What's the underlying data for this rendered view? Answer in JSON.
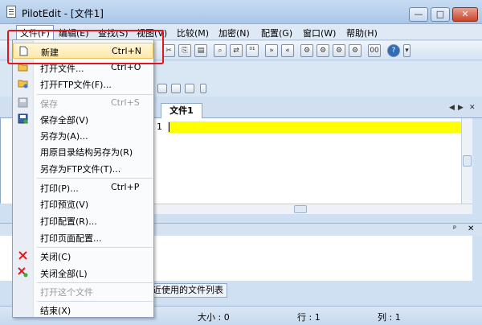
{
  "window": {
    "title": "PilotEdit - [文件1]",
    "min_label": "—",
    "max_label": "□",
    "close_label": "✕"
  },
  "menubar": {
    "items": [
      "文件(F)",
      "编辑(E)",
      "查找(S)",
      "视图(V)",
      "比较(M)",
      "加密(N)",
      "配置(G)",
      "窗口(W)",
      "帮助(H)"
    ]
  },
  "file_menu": {
    "items": [
      {
        "label": "新建",
        "shortcut": "Ctrl+N",
        "icon": "new-file-icon",
        "enabled": true,
        "highlighted": true
      },
      {
        "label": "打开文件...",
        "shortcut": "Ctrl+O",
        "icon": "open-folder-icon",
        "enabled": true
      },
      {
        "label": "打开FTP文件(F)...",
        "shortcut": "",
        "icon": "ftp-folder-icon",
        "enabled": true
      },
      {
        "label": "保存",
        "shortcut": "Ctrl+S",
        "icon": "save-icon",
        "enabled": false
      },
      {
        "label": "保存全部(V)",
        "shortcut": "",
        "icon": "save-all-icon",
        "enabled": true
      },
      {
        "label": "另存为(A)...",
        "shortcut": "",
        "enabled": true
      },
      {
        "label": "用原目录结构另存为(R)",
        "shortcut": "",
        "enabled": true
      },
      {
        "label": "另存为FTP文件(T)...",
        "shortcut": "",
        "enabled": true
      },
      {
        "label": "打印(P)...",
        "shortcut": "Ctrl+P",
        "enabled": true
      },
      {
        "label": "打印预览(V)",
        "shortcut": "",
        "enabled": true
      },
      {
        "label": "打印配置(R)...",
        "shortcut": "",
        "enabled": true
      },
      {
        "label": "打印页面配置...",
        "shortcut": "",
        "enabled": true
      },
      {
        "label": "关闭(C)",
        "shortcut": "",
        "icon": "close-icon",
        "enabled": true
      },
      {
        "label": "关闭全部(L)",
        "shortcut": "",
        "icon": "close-all-icon",
        "enabled": true
      },
      {
        "label": "打开这个文件",
        "shortcut": "",
        "enabled": false
      },
      {
        "label": "结束(X)",
        "shortcut": "",
        "enabled": true
      }
    ]
  },
  "editor": {
    "tab_label": "文件1",
    "line_number": "1"
  },
  "lower_panel": {
    "tab_label": "近使用的文件列表",
    "pin_label": "ᵖ",
    "close_label": "✕"
  },
  "statusbar": {
    "size": "大小 : 0",
    "line": "行 : 1",
    "column": "列 : 1"
  },
  "colors": {
    "accent_highlight": "#ffff00",
    "red_annotation": "#e3141c"
  }
}
